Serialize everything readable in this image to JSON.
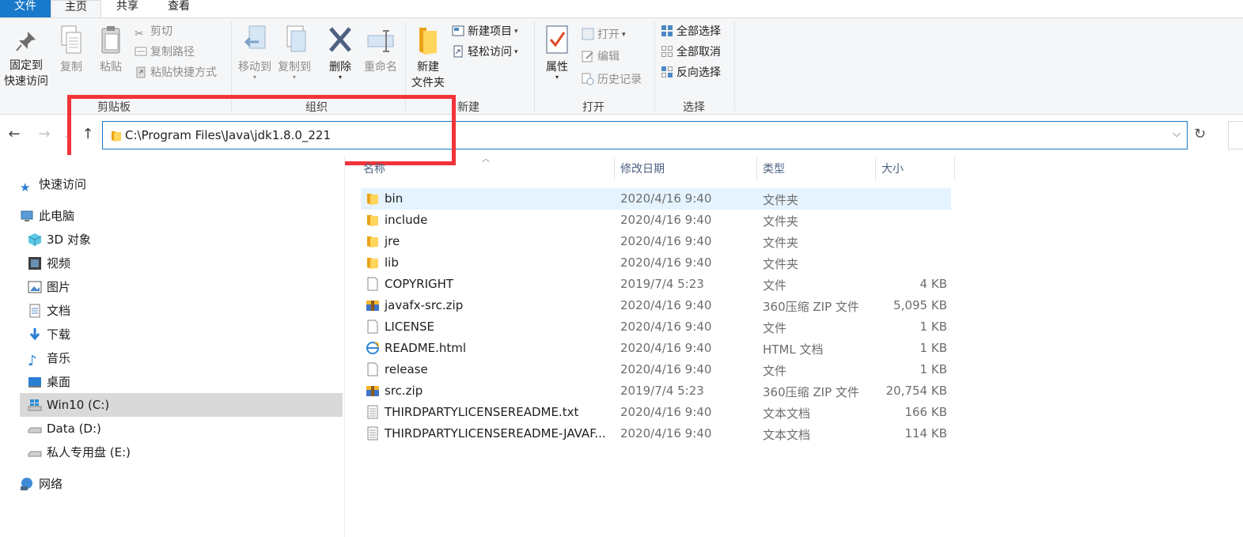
{
  "tabs": {
    "file": "文件",
    "home": "主页",
    "share": "共享",
    "view": "查看"
  },
  "ribbon": {
    "pin_line1": "固定到",
    "pin_line2": "快速访问",
    "copy": "复制",
    "paste": "粘贴",
    "cut": "剪切",
    "copy_path": "复制路径",
    "paste_shortcut": "粘贴快捷方式",
    "move_to": "移动到",
    "copy_to": "复制到",
    "delete": "删除",
    "rename": "重命名",
    "new_folder_line1": "新建",
    "new_folder_line2": "文件夹",
    "new_item": "新建项目",
    "easy_access": "轻松访问",
    "properties": "属性",
    "open": "打开",
    "edit": "编辑",
    "history": "历史记录",
    "select_all": "全部选择",
    "select_none": "全部取消",
    "invert_selection": "反向选择",
    "groups": {
      "clipboard": "剪贴板",
      "organize": "组织",
      "new": "新建",
      "open": "打开",
      "select": "选择"
    }
  },
  "address": {
    "path": "C:\\Program Files\\Java\\jdk1.8.0_221"
  },
  "nav": {
    "quick_access": "快速访问",
    "this_pc": "此电脑",
    "objects3d": "3D 对象",
    "videos": "视频",
    "pictures": "图片",
    "documents": "文档",
    "downloads": "下载",
    "music": "音乐",
    "desktop": "桌面",
    "drive_c": "Win10 (C:)",
    "drive_d": "Data (D:)",
    "drive_e": "私人专用盘 (E:)",
    "network": "网络"
  },
  "columns": {
    "name": "名称",
    "date": "修改日期",
    "type": "类型",
    "size": "大小"
  },
  "files": [
    {
      "name": "bin",
      "date": "2020/4/16 9:40",
      "type": "文件夹",
      "size": "",
      "icon": "folder-icon"
    },
    {
      "name": "include",
      "date": "2020/4/16 9:40",
      "type": "文件夹",
      "size": "",
      "icon": "folder-icon"
    },
    {
      "name": "jre",
      "date": "2020/4/16 9:40",
      "type": "文件夹",
      "size": "",
      "icon": "folder-icon"
    },
    {
      "name": "lib",
      "date": "2020/4/16 9:40",
      "type": "文件夹",
      "size": "",
      "icon": "folder-icon"
    },
    {
      "name": "COPYRIGHT",
      "date": "2019/7/4 5:23",
      "type": "文件",
      "size": "4 KB",
      "icon": "file-icon"
    },
    {
      "name": "javafx-src.zip",
      "date": "2020/4/16 9:40",
      "type": "360压缩 ZIP 文件",
      "size": "5,095 KB",
      "icon": "zip-icon"
    },
    {
      "name": "LICENSE",
      "date": "2020/4/16 9:40",
      "type": "文件",
      "size": "1 KB",
      "icon": "file-icon"
    },
    {
      "name": "README.html",
      "date": "2020/4/16 9:40",
      "type": "HTML 文档",
      "size": "1 KB",
      "icon": "html-icon"
    },
    {
      "name": "release",
      "date": "2020/4/16 9:40",
      "type": "文件",
      "size": "1 KB",
      "icon": "file-icon"
    },
    {
      "name": "src.zip",
      "date": "2019/7/4 5:23",
      "type": "360压缩 ZIP 文件",
      "size": "20,754 KB",
      "icon": "zip-icon"
    },
    {
      "name": "THIRDPARTYLICENSEREADME.txt",
      "date": "2020/4/16 9:40",
      "type": "文本文档",
      "size": "166 KB",
      "icon": "text-icon"
    },
    {
      "name": "THIRDPARTYLICENSEREADME-JAVAF...",
      "date": "2020/4/16 9:40",
      "type": "文本文档",
      "size": "114 KB",
      "icon": "text-icon"
    }
  ],
  "colors": {
    "accent": "#1979ca",
    "highlight_box": "#f2333a",
    "selected_row": "#e5f3ff",
    "selected_nav": "#d9d9d9"
  }
}
